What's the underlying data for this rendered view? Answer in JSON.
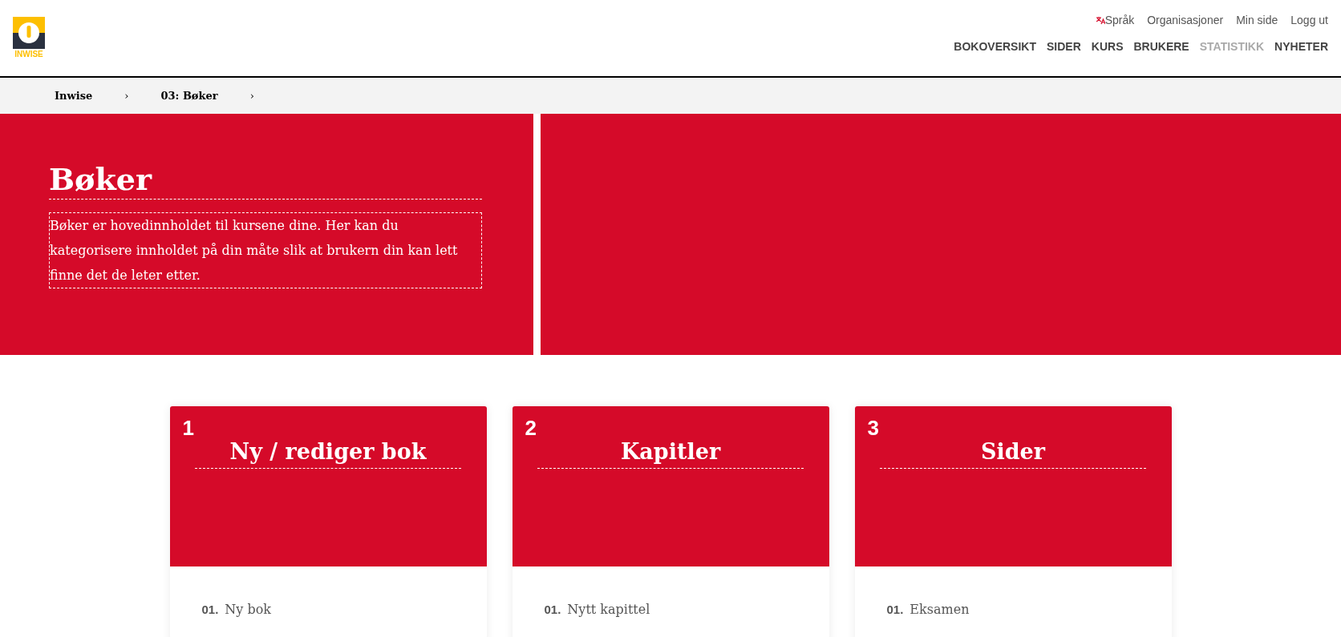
{
  "logo": {
    "text": "INWISE"
  },
  "top_links": [
    {
      "label": "Språk"
    },
    {
      "label": "Organisasjoner"
    },
    {
      "label": "Min side"
    },
    {
      "label": "Logg ut"
    }
  ],
  "main_nav": [
    {
      "label": "BOKOVERSIKT",
      "disabled": false
    },
    {
      "label": "SIDER",
      "disabled": false
    },
    {
      "label": "KURS",
      "disabled": false
    },
    {
      "label": "BRUKERE",
      "disabled": false
    },
    {
      "label": "STATISTIKK",
      "disabled": true
    },
    {
      "label": "NYHETER",
      "disabled": false
    }
  ],
  "breadcrumb": [
    "Inwise",
    "03: Bøker"
  ],
  "breadcrumb_separator": "›",
  "hero": {
    "title": "Bøker",
    "description": "Bøker er hovedinnholdet til kursene dine. Her kan du kategorisere innholdet på din måte slik at brukern din kan lett finne det de leter etter."
  },
  "cards": [
    {
      "number": "1",
      "title": "Ny / rediger bok",
      "items": [
        {
          "index": "01.",
          "label": "Ny bok"
        }
      ]
    },
    {
      "number": "2",
      "title": "Kapitler",
      "items": [
        {
          "index": "01.",
          "label": "Nytt kapittel"
        }
      ]
    },
    {
      "number": "3",
      "title": "Sider",
      "items": [
        {
          "index": "01.",
          "label": "Eksamen"
        }
      ]
    }
  ]
}
